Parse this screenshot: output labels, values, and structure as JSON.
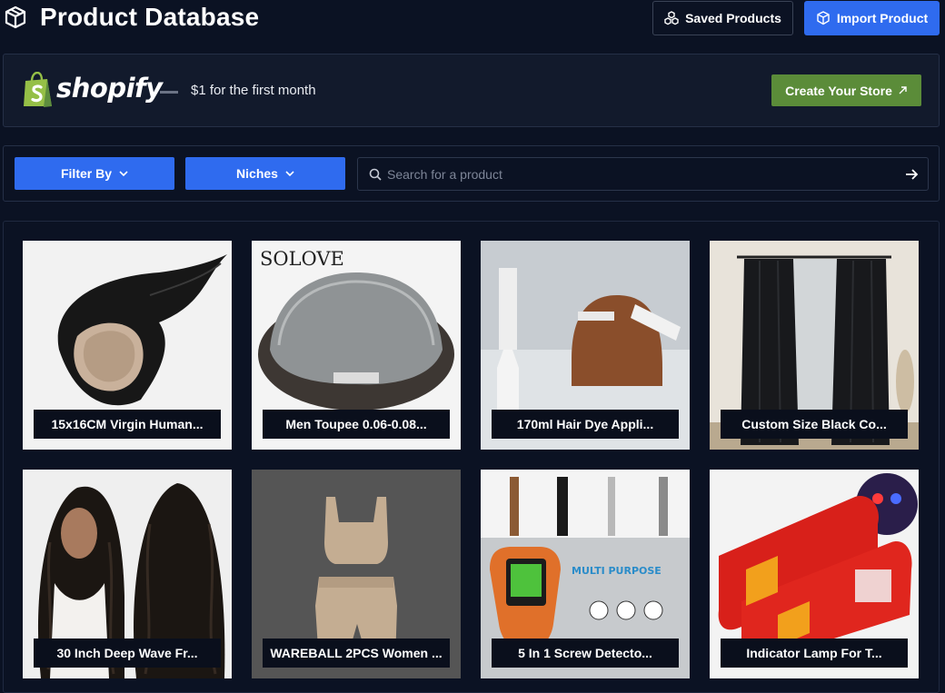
{
  "header": {
    "title": "Product Database",
    "saved_label": "Saved Products",
    "import_label": "Import Product"
  },
  "promo": {
    "brand": "shopify",
    "offer": "$1 for the first month",
    "cta_label": "Create Your Store"
  },
  "filters": {
    "filter_label": "Filter By",
    "niches_label": "Niches",
    "search_placeholder": "Search for a product"
  },
  "products": [
    {
      "title": "15x16CM Virgin Human..."
    },
    {
      "title": "Men Toupee 0.06-0.08..."
    },
    {
      "title": "170ml Hair Dye Appli..."
    },
    {
      "title": "Custom Size Black Co..."
    },
    {
      "title": "30 Inch Deep Wave Fr..."
    },
    {
      "title": "WAREBALL 2PCS Women ..."
    },
    {
      "title": "5 In 1 Screw Detecto..."
    },
    {
      "title": "Indicator Lamp For T..."
    }
  ],
  "product_image_text": {
    "toupee_brand": "SOLOVE",
    "detector_caption": "MULTI PURPOSE"
  },
  "colors": {
    "background": "#0b1223",
    "primary": "#2f6bef",
    "shopify_green": "#5b8c39",
    "panel_border": "#253047"
  }
}
